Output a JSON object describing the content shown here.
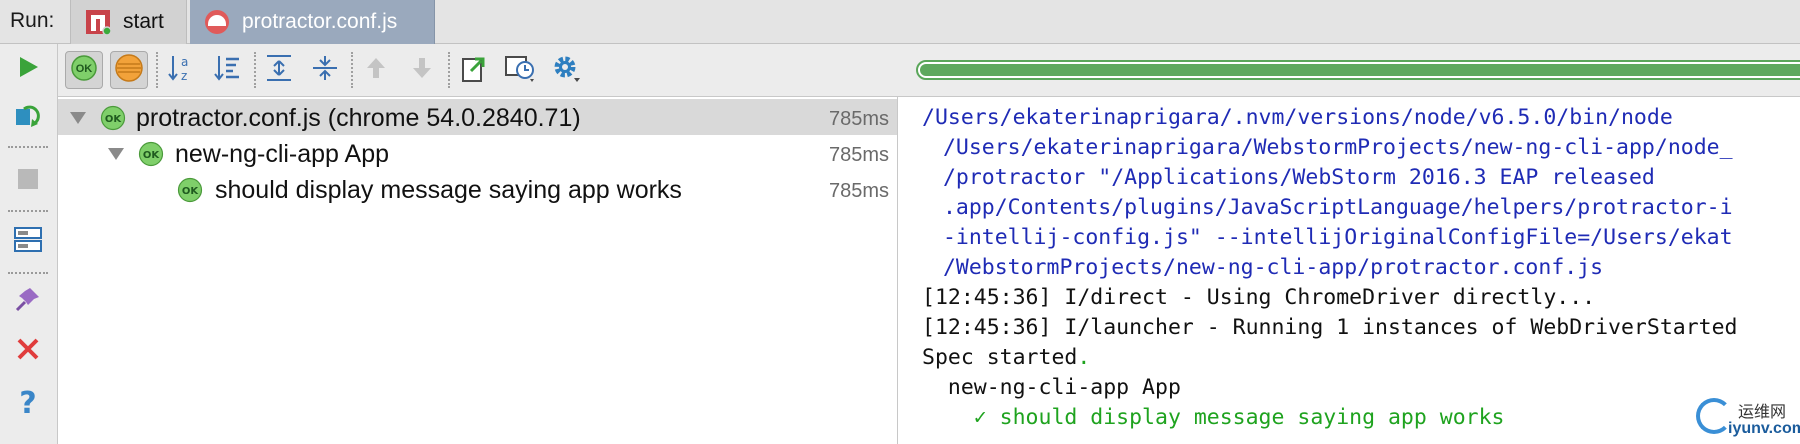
{
  "run_panel": {
    "label": "Run:",
    "tabs": [
      {
        "label": "start",
        "icon": "npm-icon",
        "active": false
      },
      {
        "label": "protractor.conf.js",
        "icon": "protractor-icon",
        "active": true
      }
    ]
  },
  "left_toolbar": {
    "items": [
      "rerun-icon",
      "rerun-failed-icon",
      "stop-icon",
      "restore-layout-icon",
      "pin-icon",
      "close-icon",
      "help-icon"
    ]
  },
  "top_toolbar": {
    "items": [
      "show-passed-icon",
      "show-ignored-icon",
      "sort-alphabetically-icon",
      "sort-by-duration-icon",
      "expand-all-icon",
      "collapse-all-icon",
      "previous-failed-icon",
      "next-failed-icon",
      "export-results-icon",
      "test-history-icon",
      "settings-icon"
    ],
    "ok_badge": "OK",
    "progress_fraction": 1.0
  },
  "test_tree": {
    "rows": [
      {
        "label": "protractor.conf.js (chrome 54.0.2840.71)",
        "duration": "785ms",
        "status": "passed"
      },
      {
        "label": "new-ng-cli-app App",
        "duration": "785ms",
        "status": "passed"
      },
      {
        "label": "should display message saying app works",
        "duration": "785ms",
        "status": "passed"
      }
    ]
  },
  "console": {
    "lines": [
      "/Users/ekaterinaprigara/.nvm/versions/node/v6.5.0/bin/node",
      " /Users/ekaterinaprigara/WebstormProjects/new-ng-cli-app/node_",
      " /protractor \"/Applications/WebStorm 2016.3 EAP released",
      " .app/Contents/plugins/JavaScriptLanguage/helpers/protractor-i",
      " -intellij-config.js\" --intellijOriginalConfigFile=/Users/ekat",
      " /WebstormProjects/new-ng-cli-app/protractor.conf.js",
      "[12:45:36] I/direct - Using ChromeDriver directly...",
      "[12:45:36] I/launcher - Running 1 instances of WebDriverStarted",
      "Spec started",
      "  new-ng-cli-app App",
      "    ✓ should display message saying app works"
    ],
    "spec_dot": "."
  },
  "watermark": {
    "cn": "运维网",
    "url": "iyunv.com"
  },
  "colors": {
    "console_path": "#1f2bb5",
    "passed": "#1fa31f",
    "active_tab": "#9aa9bd"
  }
}
